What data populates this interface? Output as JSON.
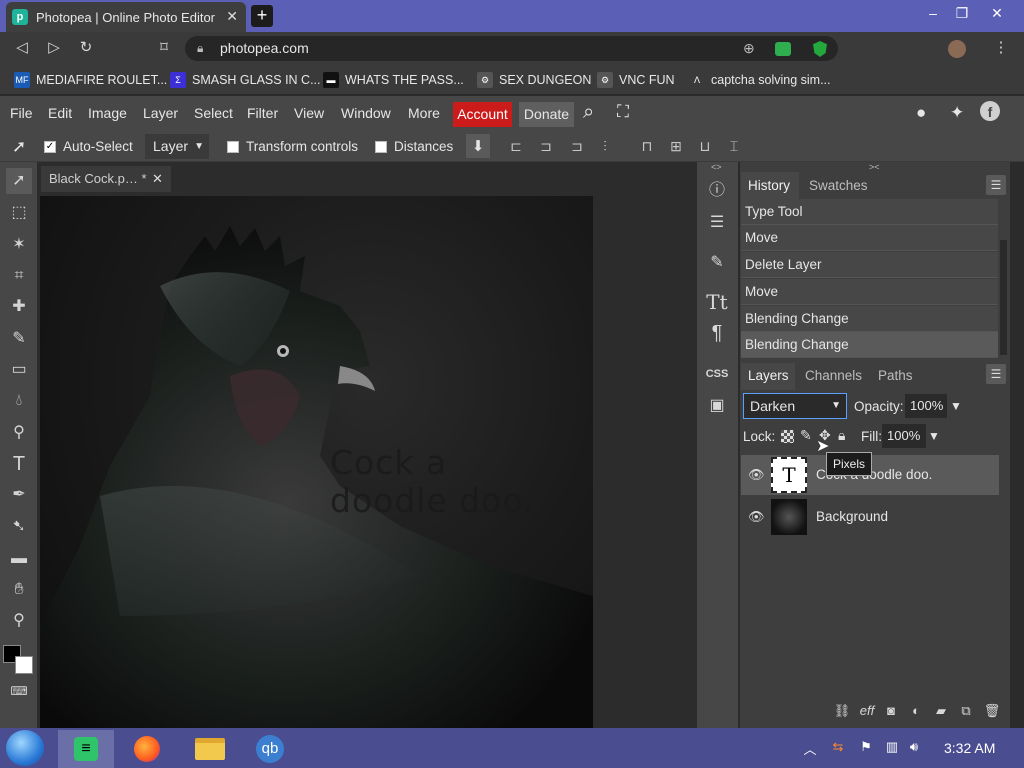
{
  "browser": {
    "tab_title": "Photopea | Online Photo Editor",
    "tab_close": "✕",
    "new_tab": "+",
    "url": "photopea.com",
    "window_controls": [
      "–",
      "❐",
      "✕"
    ]
  },
  "bookmarks": [
    {
      "label": "MEDIAFIRE ROULET...",
      "icon": "MF",
      "color": "#1a5bb5"
    },
    {
      "label": "SMASH GLASS IN C...",
      "icon": "Σ",
      "color": "#3b2fd6"
    },
    {
      "label": "WHATS THE PASS...",
      "icon": "▬",
      "color": "#111111"
    },
    {
      "label": "SEX DUNGEON",
      "icon": "⚙",
      "color": "#555555"
    },
    {
      "label": "VNC FUN",
      "icon": "⚙",
      "color": "#555555"
    },
    {
      "label": "captcha solving sim...",
      "icon": "Λ",
      "color": "#3a3a3a"
    }
  ],
  "menu": {
    "items": [
      "File",
      "Edit",
      "Image",
      "Layer",
      "Select",
      "Filter",
      "View",
      "Window",
      "More"
    ],
    "account": "Account",
    "donate": "Donate"
  },
  "options": {
    "auto_select": "Auto-Select",
    "auto_select_checked": true,
    "layer_dropdown": "Layer",
    "transform_controls": "Transform controls",
    "distances": "Distances"
  },
  "document": {
    "tab_title": "Black Cock.p… *",
    "tab_close": "✕",
    "canvas_text": "Cock a\ndoodle doo."
  },
  "history": {
    "tabs": [
      "History",
      "Swatches"
    ],
    "items": [
      "Type Tool",
      "Move",
      "Delete Layer",
      "Move",
      "Blending Change",
      "Blending Change"
    ]
  },
  "layers": {
    "tabs": [
      "Layers",
      "Channels",
      "Paths"
    ],
    "blend_mode": "Darken",
    "opacity_label": "Opacity:",
    "opacity": "100%",
    "lock_label": "Lock:",
    "fill_label": "Fill:",
    "fill": "100%",
    "tooltip": "Pixels",
    "items": [
      {
        "name": "Cock a doodle doo.",
        "thumb": "T"
      },
      {
        "name": "Background"
      }
    ]
  },
  "taskbar": {
    "time": "3:32 AM"
  }
}
